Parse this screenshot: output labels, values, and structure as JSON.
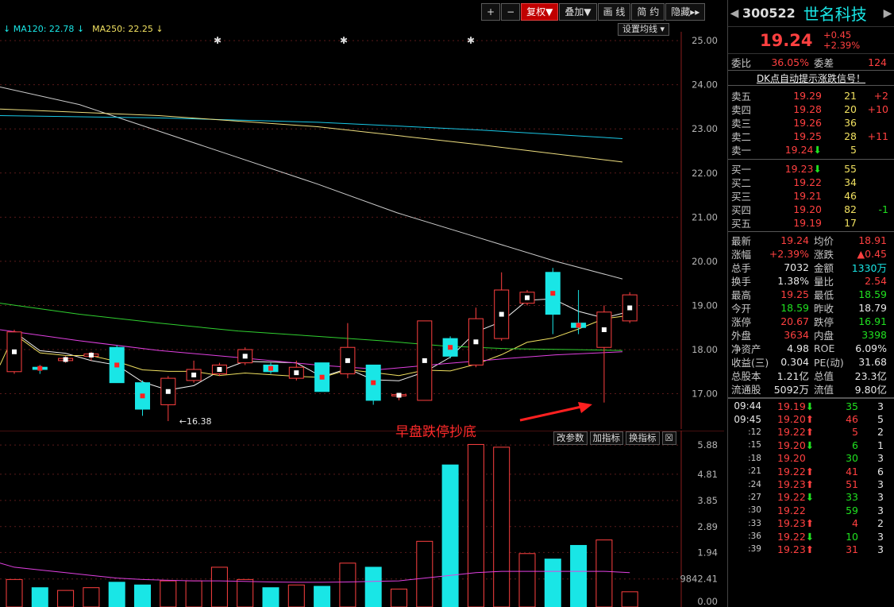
{
  "toolbar": {
    "buttons": [
      "+",
      "−",
      "复权▼",
      "叠加▼",
      "画 线",
      "简 约",
      "隐藏▸▸"
    ]
  },
  "ma_legend": {
    "ma120": "↓ MA120: 22.78 ↓",
    "ma250": "MA250: 22.25 ↓"
  },
  "set_ma_label": "设置均线 ▾",
  "price_axis": [
    "25.00",
    "24.00",
    "23.00",
    "22.00",
    "21.00",
    "20.00",
    "19.00",
    "18.00",
    "17.00"
  ],
  "low_label": "16.38",
  "vol_axis": [
    "5.88",
    "4.81",
    "3.85",
    "2.89",
    "1.94",
    "9842.41",
    "0.00"
  ],
  "vol_buttons": [
    "改参数",
    "加指标",
    "换指标",
    "☒"
  ],
  "annotation": "早盘跌停抄底",
  "colors": {
    "up": "#ff4040",
    "down": "#19e6e6",
    "bg": "#000000"
  },
  "chart_data": {
    "type": "candlestick",
    "ylim": [
      16.2,
      25.2
    ],
    "candles": [
      {
        "o": 17.5,
        "h": 18.45,
        "l": 17.45,
        "c": 18.4
      },
      {
        "o": 17.6,
        "h": 17.65,
        "l": 17.45,
        "c": 17.55
      },
      {
        "o": 17.75,
        "h": 17.85,
        "l": 17.7,
        "c": 17.8
      },
      {
        "o": 17.85,
        "h": 17.95,
        "l": 17.75,
        "c": 17.9
      },
      {
        "o": 18.05,
        "h": 18.1,
        "l": 17.25,
        "c": 17.25
      },
      {
        "o": 17.25,
        "h": 17.3,
        "l": 16.5,
        "c": 16.65
      },
      {
        "o": 16.75,
        "h": 17.4,
        "l": 16.38,
        "c": 17.35
      },
      {
        "o": 17.3,
        "h": 17.75,
        "l": 17.25,
        "c": 17.55
      },
      {
        "o": 17.45,
        "h": 17.7,
        "l": 17.4,
        "c": 17.65
      },
      {
        "o": 17.7,
        "h": 18.05,
        "l": 17.65,
        "c": 18.0
      },
      {
        "o": 17.65,
        "h": 17.7,
        "l": 17.45,
        "c": 17.5
      },
      {
        "o": 17.35,
        "h": 17.75,
        "l": 17.3,
        "c": 17.6
      },
      {
        "o": 17.7,
        "h": 17.7,
        "l": 17.05,
        "c": 17.05
      },
      {
        "o": 17.45,
        "h": 18.6,
        "l": 17.35,
        "c": 18.05
      },
      {
        "o": 17.65,
        "h": 17.65,
        "l": 16.75,
        "c": 16.85
      },
      {
        "o": 16.95,
        "h": 17.0,
        "l": 16.85,
        "c": 16.98
      },
      {
        "o": 16.85,
        "h": 18.65,
        "l": 16.85,
        "c": 18.65
      },
      {
        "o": 18.25,
        "h": 18.3,
        "l": 17.8,
        "c": 17.85
      },
      {
        "o": 17.65,
        "h": 18.95,
        "l": 17.6,
        "c": 18.7
      },
      {
        "o": 18.25,
        "h": 19.75,
        "l": 18.2,
        "c": 19.35
      },
      {
        "o": 19.05,
        "h": 19.35,
        "l": 19.0,
        "c": 19.3
      },
      {
        "o": 19.75,
        "h": 19.85,
        "l": 18.35,
        "c": 18.8
      },
      {
        "o": 18.6,
        "h": 19.35,
        "l": 18.35,
        "c": 18.5
      },
      {
        "o": 18.05,
        "h": 19.0,
        "l": 16.8,
        "c": 18.85
      },
      {
        "o": 18.65,
        "h": 19.3,
        "l": 18.6,
        "c": 19.24
      }
    ],
    "volume": {
      "ylim": [
        0,
        6.0
      ],
      "values": [
        0.95,
        0.65,
        0.55,
        0.65,
        0.85,
        0.75,
        0.9,
        0.9,
        1.4,
        0.95,
        0.65,
        0.75,
        0.7,
        1.55,
        1.4,
        0.6,
        2.35,
        5.15,
        5.9,
        5.8,
        1.9,
        1.7,
        2.2,
        2.4,
        0.5
      ],
      "ma": [
        1.4,
        1.3,
        1.2,
        1.1,
        1.0,
        0.95,
        0.92,
        0.9,
        0.9,
        0.88,
        0.86,
        0.85,
        0.85,
        0.86,
        0.88,
        0.9,
        1.0,
        1.1,
        1.2,
        1.25,
        1.25,
        1.25,
        1.25,
        1.25,
        1.2
      ]
    }
  },
  "panel": {
    "code": "300522",
    "name": "世名科技",
    "price": "19.24",
    "chg": "+0.45",
    "chg_pct": "+2.39%",
    "weibi_lbl": "委比",
    "weibi": "36.05%",
    "weicha_lbl": "委差",
    "weicha": "124",
    "signal": "DK点自动提示涨跌信号！",
    "asks": [
      {
        "lbl": "卖五",
        "price": "19.29",
        "vol": "21",
        "delta": "+2"
      },
      {
        "lbl": "卖四",
        "price": "19.28",
        "vol": "20",
        "delta": "+10"
      },
      {
        "lbl": "卖三",
        "price": "19.26",
        "vol": "36",
        "delta": ""
      },
      {
        "lbl": "卖二",
        "price": "19.25",
        "vol": "28",
        "delta": "+11"
      },
      {
        "lbl": "卖一",
        "price": "19.24⬇",
        "vol": "5",
        "delta": ""
      }
    ],
    "bids": [
      {
        "lbl": "买一",
        "price": "19.23⬇",
        "vol": "55",
        "delta": ""
      },
      {
        "lbl": "买二",
        "price": "19.22",
        "vol": "34",
        "delta": ""
      },
      {
        "lbl": "买三",
        "price": "19.21",
        "vol": "46",
        "delta": ""
      },
      {
        "lbl": "买四",
        "price": "19.20",
        "vol": "82",
        "delta": "-1"
      },
      {
        "lbl": "买五",
        "price": "19.19",
        "vol": "17",
        "delta": ""
      }
    ],
    "stats": [
      [
        "最新",
        "19.24",
        "均价",
        "18.91"
      ],
      [
        "涨幅",
        "+2.39%",
        "涨跌",
        "▲0.45"
      ],
      [
        "总手",
        "7032",
        "金额",
        "1330万"
      ],
      [
        "换手",
        "1.38%",
        "量比",
        "2.54"
      ],
      [
        "最高",
        "19.25",
        "最低",
        "18.59"
      ],
      [
        "今开",
        "18.59",
        "昨收",
        "18.79"
      ],
      [
        "涨停",
        "20.67",
        "跌停",
        "16.91"
      ],
      [
        "外盘",
        "3634",
        "内盘",
        "3398"
      ],
      [
        "净资产",
        "4.98",
        "ROE",
        "6.09%"
      ],
      [
        "收益(三)",
        "0.304",
        "PE(动)",
        "31.68"
      ],
      [
        "总股本",
        "1.21亿",
        "总值",
        "23.3亿"
      ],
      [
        "流通股",
        "5092万",
        "流值",
        "9.80亿"
      ]
    ],
    "ticks": [
      [
        "09:44",
        "19.19⬇",
        "35",
        "3"
      ],
      [
        "09:45",
        "19.20⬆",
        "46",
        "5"
      ],
      [
        ":12",
        "19.22⬆",
        "5",
        "2"
      ],
      [
        ":15",
        "19.20⬇",
        "6",
        "1"
      ],
      [
        ":18",
        "19.20",
        "30",
        "3"
      ],
      [
        ":21",
        "19.22⬆",
        "41",
        "6"
      ],
      [
        ":24",
        "19.23⬆",
        "51",
        "3"
      ],
      [
        ":27",
        "19.22⬇",
        "33",
        "3"
      ],
      [
        ":30",
        "19.22",
        "59",
        "3"
      ],
      [
        ":33",
        "19.23⬆",
        "4",
        "2"
      ],
      [
        ":36",
        "19.22⬇",
        "10",
        "3"
      ],
      [
        ":39",
        "19.23⬆",
        "31",
        "3"
      ]
    ]
  }
}
